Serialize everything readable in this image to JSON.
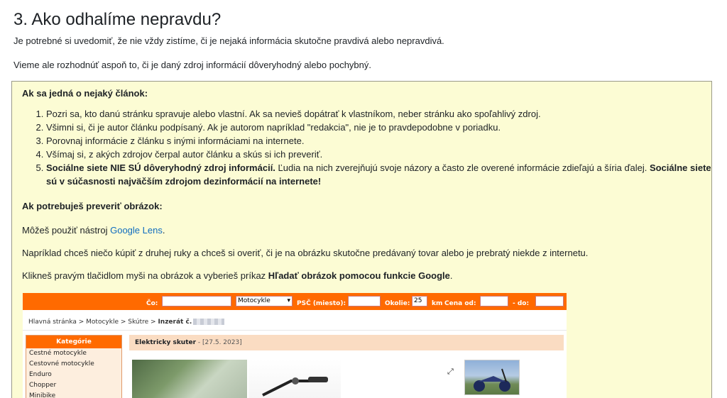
{
  "heading": "3. Ako odhalíme nepravdu?",
  "intro": [
    "Je potrebné si uvedomiť, že nie vždy zistíme, či je nejaká informácia skutočne pravdivá alebo nepravdivá.",
    "Vieme ale rozhodnúť aspoň to, či je daný zdroj informácií dôveryhodný alebo pochybný."
  ],
  "box": {
    "article_heading": "Ak sa jedná o nejaký článok:",
    "steps": [
      "Pozri sa, kto danú stránku spravuje alebo vlastní. Ak sa nevieš dopátrať k vlastníkom, neber stránku ako spoľahlivý zdroj.",
      "Všimni si, či je autor článku podpísaný. Ak je autorom napríklad \"redakcia\", nie je to pravdepodobne v poriadku.",
      "Porovnaj informácie z článku s inými informáciami na internete.",
      "Všímaj si, z akých zdrojov čerpal autor článku a skús si ich preveriť."
    ],
    "step5": {
      "bold_a": "Sociálne siete NIE SÚ dôveryhodný zdroj informácií.",
      "text": " Ľudia na nich zverejňujú svoje názory a často zle overené informácie zdieľajú a šíria ďalej. ",
      "bold_b": "Sociálne siete sú v súčasnosti najväčším zdrojom dezinformácií na internete!"
    },
    "image_heading": "Ak potrebuješ preveriť obrázok:",
    "lens_text": "Môžeš použiť nástroj ",
    "lens_link": "Google Lens",
    "lens_end": ".",
    "buy_text": "Napríklad chceš niečo kúpiť z druhej ruky a chceš si overiť, či je na obrázku skutočne predávaný tovar alebo je prebratý niekde z internetu.",
    "click_text": "Klikneš pravým tlačidlom myši na obrázok a vyberieš príkaz ",
    "click_bold": "Hľadať obrázok pomocou funkcie Google",
    "click_end": "."
  },
  "screenshot": {
    "search": {
      "co_label": "Čo:",
      "co_value": "",
      "category_value": "Motocykle",
      "psc_label": "PSČ (miesto):",
      "okolie_label": "Okolie:",
      "okolie_value": "25",
      "km_label": "km",
      "cena_label": "Cena od:",
      "do_label": "- do:"
    },
    "breadcrumb": "Hlavná stránka > Motocykle > Skútre > ",
    "breadcrumb_bold": "Inzerát č.",
    "sidebar_title": "Kategórie",
    "sidebar_items": [
      "Cestné motocykle",
      "Cestovné motocykle",
      "Enduro",
      "Chopper",
      "Minibike"
    ],
    "listing_title": "Elektricky skuter",
    "listing_date": " - [27.5. 2023]"
  },
  "colors": {
    "accent_orange": "#ff6a00",
    "note_background": "#fcfcd4",
    "link": "#0f6cbf"
  }
}
